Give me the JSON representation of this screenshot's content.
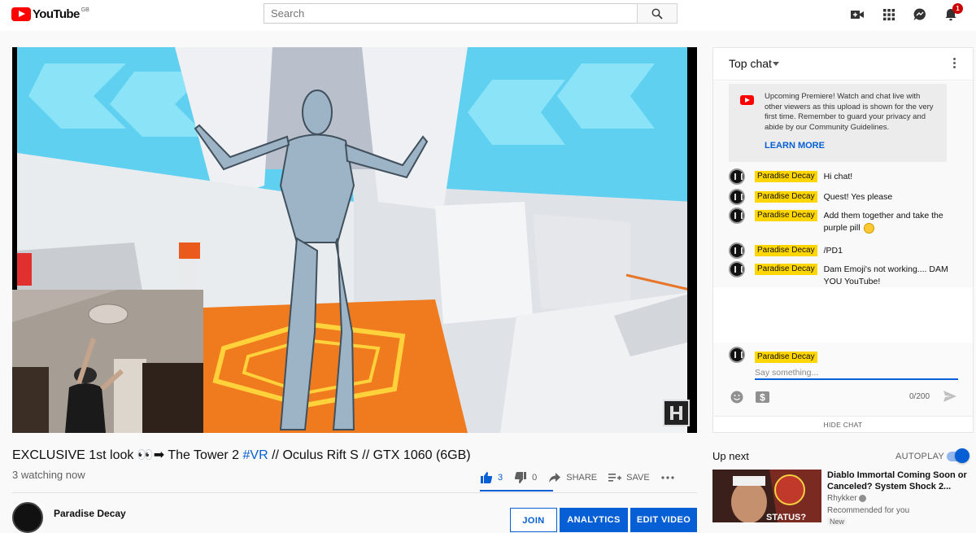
{
  "header": {
    "logo_text": "YouTube",
    "logo_region": "GB",
    "search_placeholder": "Search",
    "notification_count": "1",
    "icons": [
      "create-video-icon",
      "apps-grid-icon",
      "messages-icon",
      "notifications-bell-icon"
    ]
  },
  "video": {
    "title_prefix": "EXCLUSIVE 1st look 👀➡ The Tower 2 ",
    "title_tag": "#VR",
    "title_suffix": " // Oculus Rift S // GTX 1060 (6GB)",
    "watching": "3 watching now",
    "likes": "3",
    "dislikes": "0",
    "like_fraction": 1.0,
    "share_label": "SHARE",
    "save_label": "SAVE"
  },
  "channel": {
    "name": "Paradise Decay",
    "join_label": "JOIN",
    "analytics_label": "ANALYTICS",
    "edit_label": "EDIT VIDEO"
  },
  "chat": {
    "title": "Top chat",
    "premiere_text": "Upcoming Premiere! Watch and chat live with other viewers as this upload is shown for the very first time. Remember to guard your privacy and abide by our Community Guidelines.",
    "learn_more": "LEARN MORE",
    "messages": [
      {
        "author": "Paradise Decay",
        "text": "Hi chat!"
      },
      {
        "author": "Paradise Decay",
        "text": "Quest! Yes please"
      },
      {
        "author": "Paradise Decay",
        "text": "Add them together and take the purple pill"
      },
      {
        "author": "Paradise Decay",
        "text": "/PD1"
      },
      {
        "author": "Paradise Decay",
        "text": "Dam Emoji's not working.... DAM YOU YouTube!"
      }
    ],
    "composer_author": "Paradise Decay",
    "composer_placeholder": "Say something...",
    "char_count": "0/200",
    "hide_chat": "HIDE CHAT"
  },
  "upnext": {
    "heading": "Up next",
    "autoplay_label": "AUTOPLAY",
    "autoplay_on": true,
    "item": {
      "title": "Diablo Immortal Coming Soon or Canceled? System Shock 2...",
      "channel": "Rhykker",
      "subtitle": "Recommended for you",
      "badge": "New",
      "thumb_text": "STATUS?"
    }
  },
  "colors": {
    "brand_red": "#ff0000",
    "accent_blue": "#065fd4",
    "author_highlight": "#ffd600"
  }
}
